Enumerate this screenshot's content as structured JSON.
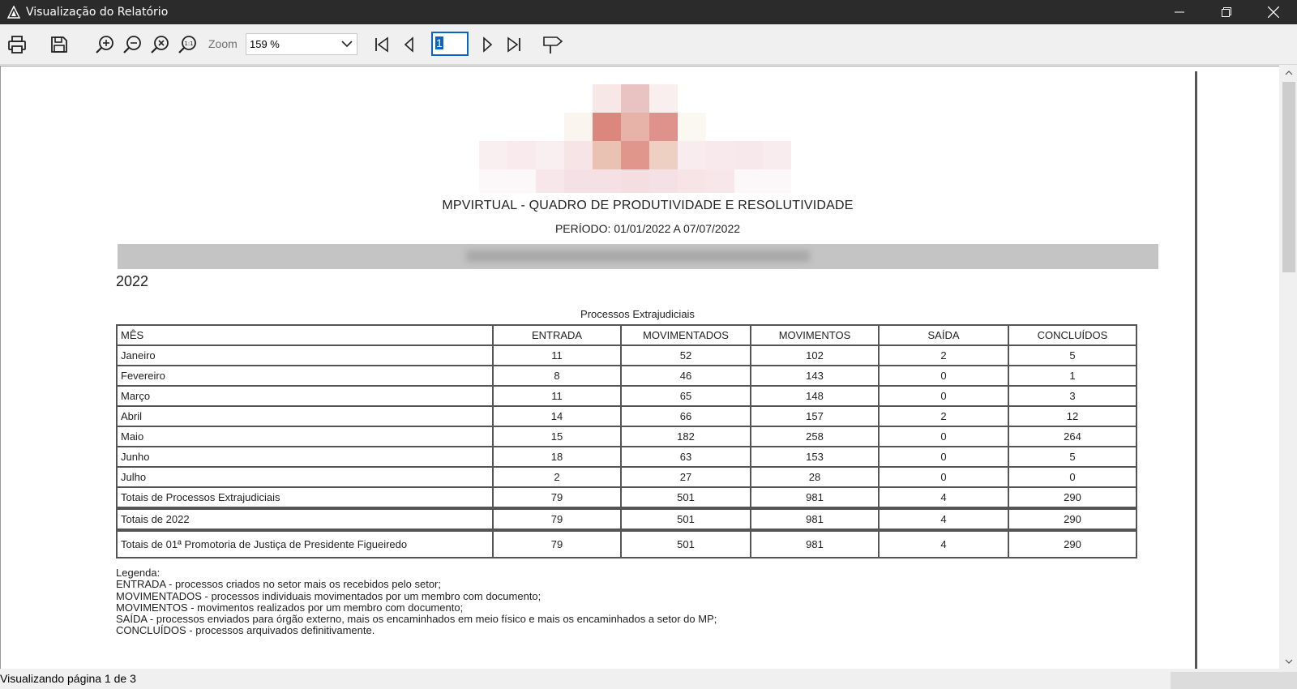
{
  "window": {
    "title": "Visualização do Relatório"
  },
  "toolbar": {
    "zoom_label": "Zoom",
    "zoom_value": "159 %",
    "page_value": "1",
    "icons": [
      "printer-icon",
      "save-icon",
      "zoom-in-icon",
      "zoom-out-icon",
      "zoom-reset-icon",
      "zoom-actual-size-icon",
      "chevron-down-icon",
      "first-page-icon",
      "previous-page-icon",
      "next-page-icon",
      "last-page-icon",
      "highlight-icon"
    ]
  },
  "report": {
    "title": "MPVIRTUAL - QUADRO DE PRODUTIVIDADE E RESOLUTIVIDADE",
    "period": "PERÍODO: 01/01/2022 A 07/07/2022",
    "year": "2022",
    "table_caption": "Processos Extrajudiciais",
    "headers": [
      "MÊS",
      "ENTRADA",
      "MOVIMENTADOS",
      "MOVIMENTOS",
      "SAÍDA",
      "CONCLUÍDOS"
    ],
    "rows": [
      [
        "Janeiro",
        "11",
        "52",
        "102",
        "2",
        "5"
      ],
      [
        "Fevereiro",
        "8",
        "46",
        "143",
        "0",
        "1"
      ],
      [
        "Março",
        "11",
        "65",
        "148",
        "0",
        "3"
      ],
      [
        "Abril",
        "14",
        "66",
        "157",
        "2",
        "12"
      ],
      [
        "Maio",
        "15",
        "182",
        "258",
        "0",
        "264"
      ],
      [
        "Junho",
        "18",
        "63",
        "153",
        "0",
        "5"
      ],
      [
        "Julho",
        "2",
        "27",
        "28",
        "0",
        "0"
      ],
      [
        "Totais de Processos Extrajudiciais",
        "79",
        "501",
        "981",
        "4",
        "290"
      ]
    ],
    "total_year": [
      "Totais de 2022",
      "79",
      "501",
      "981",
      "4",
      "290"
    ],
    "total_office": [
      "Totais de 01ª Promotoria de Justiça de Presidente Figueiredo",
      "79",
      "501",
      "981",
      "4",
      "290"
    ],
    "legend": [
      "Legenda:",
      "ENTRADA - processos criados no setor mais os recebidos pelo setor;",
      "MOVIMENTADOS - processos individuais movimentados por um membro com documento;",
      "MOVIMENTOS - movimentos realizados por um membro com documento;",
      "SAÍDA - processos enviados para órgão externo, mais os encaminhados em meio físico e mais os encaminhados a setor do MP;",
      "CONCLUÍDOS - processos arquivados definitivamente."
    ]
  },
  "statusbar": {
    "text": "Visualizando página 1 de 3"
  },
  "colors": {
    "titlebar_bg": "#2b2b2b",
    "toolbar_bg": "#f0f0f0",
    "page_input_border": "#0a64c8",
    "table_border": "#555555",
    "band_gray": "#c4c4c4"
  }
}
